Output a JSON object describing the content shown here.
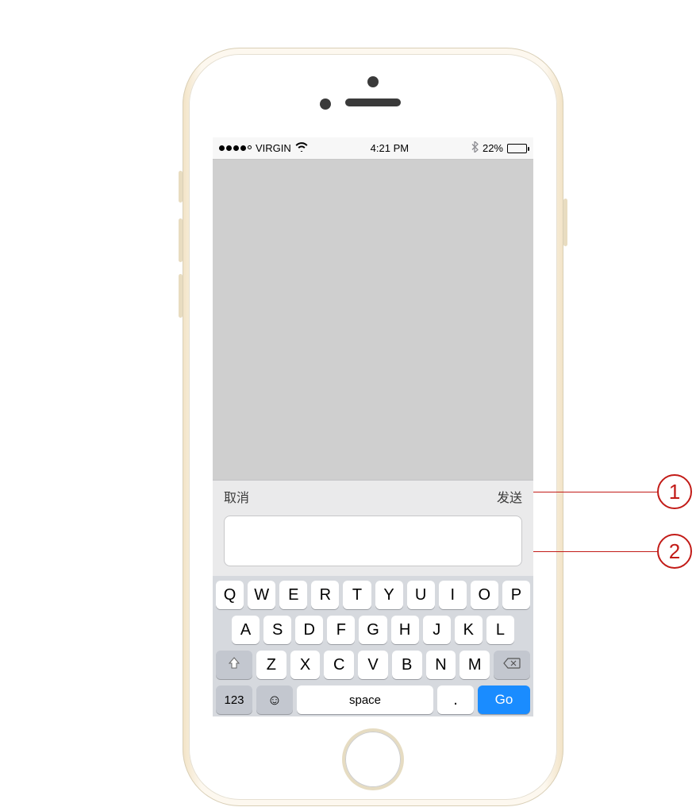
{
  "status": {
    "carrier": "VIRGIN",
    "time": "4:21 PM",
    "battery_pct": "22%",
    "battery_fill_pct": 22
  },
  "compose": {
    "cancel_label": "取消",
    "send_label": "发送",
    "input_value": ""
  },
  "keyboard": {
    "row1": [
      "Q",
      "W",
      "E",
      "R",
      "T",
      "Y",
      "U",
      "I",
      "O",
      "P"
    ],
    "row2": [
      "A",
      "S",
      "D",
      "F",
      "G",
      "H",
      "J",
      "K",
      "L"
    ],
    "row3": [
      "Z",
      "X",
      "C",
      "V",
      "B",
      "N",
      "M"
    ],
    "mode_label": "123",
    "space_label": "space",
    "dot_label": ".",
    "go_label": "Go"
  },
  "callouts": {
    "c1": "1",
    "c2": "2"
  }
}
